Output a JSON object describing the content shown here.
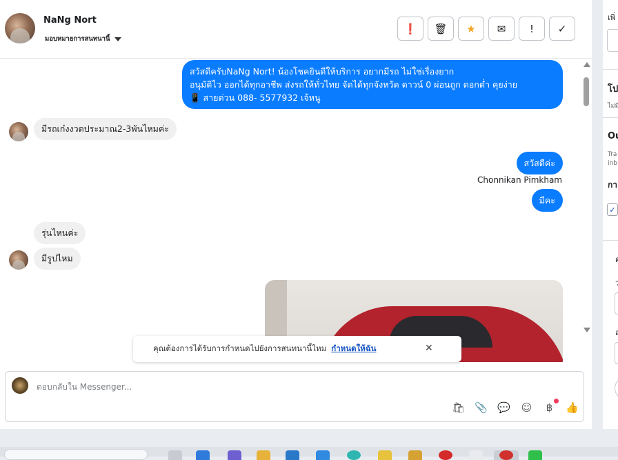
{
  "header": {
    "contact_name": "NaNg Nort",
    "assign_label": "มอบหมายการสนทนานี้",
    "actions": [
      {
        "icon": "alert-circle-icon",
        "glyph": "❗"
      },
      {
        "icon": "trash-icon",
        "glyph": "🗑"
      },
      {
        "icon": "star-icon",
        "glyph": "★"
      },
      {
        "icon": "mail-icon",
        "glyph": "✉"
      },
      {
        "icon": "exclamation-icon",
        "glyph": "!"
      },
      {
        "icon": "check-icon",
        "glyph": "✓"
      }
    ]
  },
  "messages": {
    "greeting_line1": "สวัสดีครับNaNg Nort! น้องโชคยินดีให้บริการ อยากมีรถ ไม่ใช่เรื่องยาก",
    "greeting_line2": "อนุมัติไว ออกได้ทุกอาชีพ ส่งรถให้ทั่วไทย จัดได้ทุกจังหวัด ดาวน์ 0  ผ่อนถูก ดอกต่ำ คุยง่าย",
    "greeting_line3": "📱 สายด่วน 088- 5577932 เจ้หนู",
    "in_1": "มีรถเก๋งงวดประมาณ2-3พันไหมค่ะ",
    "out_hello": "สวัสดีค่ะ",
    "agent_name": "Chonnikan Pimkham",
    "out_have": "มีคะ",
    "in_2": "รุ่นไหนค่ะ",
    "in_3": "มีรูปไหม"
  },
  "notice": {
    "text": "คุณต้องการได้รับการกำหนดไปยังการสนทนานี้ไหม",
    "link": "กำหนดให้ฉัน",
    "close": "✕"
  },
  "composer": {
    "placeholder": "ตอบกลับใน Messenger...",
    "tools": [
      {
        "icon": "shopping-bag-icon",
        "glyph": "🛍"
      },
      {
        "icon": "paperclip-icon",
        "glyph": "📎"
      },
      {
        "icon": "saved-reply-icon",
        "glyph": "💬"
      },
      {
        "icon": "emoji-icon",
        "glyph": "☺"
      },
      {
        "icon": "baht-payment-icon",
        "glyph": "฿"
      },
      {
        "icon": "thumbs-up-icon",
        "glyph": "👍"
      }
    ]
  },
  "right_panel": {
    "t1": "เพิ่",
    "t2": "โป",
    "t3": "ไม่มี",
    "t4": "Ou",
    "t5": "Tra",
    "t6": "inb",
    "t7": "กา",
    "t8": "ค",
    "t9": "ว",
    "t10": "อ"
  },
  "colors": {
    "outgoing_bubble": "#0a7cff",
    "incoming_bubble": "#f0f0f0",
    "star": "#f5a623",
    "link": "#1a56c4"
  }
}
